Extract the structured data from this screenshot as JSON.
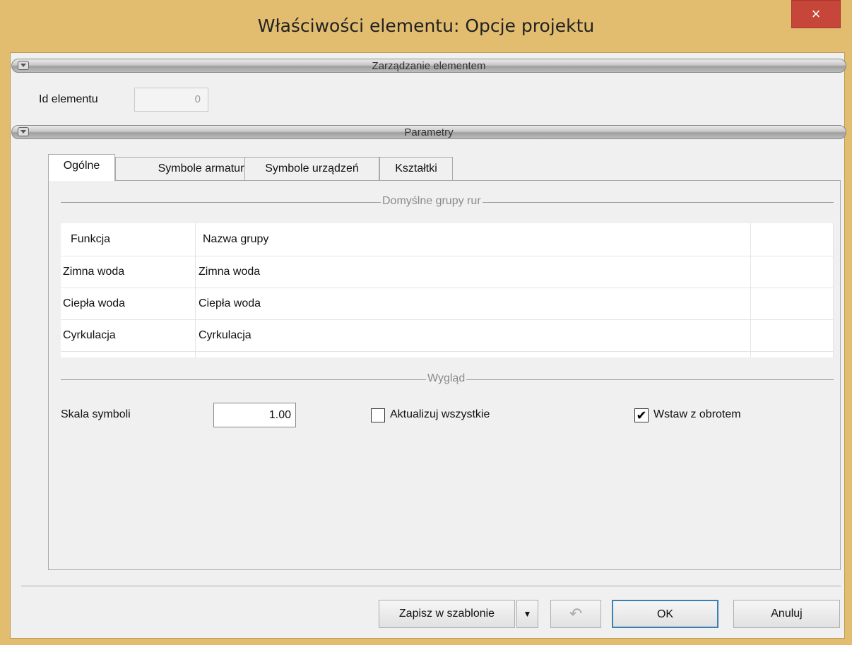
{
  "window": {
    "title": "Właściwości elementu: Opcje projektu",
    "close_glyph": "×"
  },
  "sections": {
    "management": "Zarządzanie elementem",
    "parameters": "Parametry"
  },
  "element_id": {
    "label": "Id elementu",
    "value": "0"
  },
  "tabs": [
    {
      "label": "Ogólne",
      "active": true
    },
    {
      "label": "Symbole armatury",
      "active": false
    },
    {
      "label": "Symbole urządzeń",
      "active": false
    },
    {
      "label": "Kształtki",
      "active": false
    }
  ],
  "pipe_groups": {
    "title": "Domyślne grupy rur",
    "columns": [
      "Funkcja",
      "Nazwa grupy"
    ],
    "rows": [
      {
        "function": "Zimna woda",
        "group": "Zimna woda"
      },
      {
        "function": "Ciepła woda",
        "group": "Ciepła woda"
      },
      {
        "function": "Cyrkulacja",
        "group": "Cyrkulacja"
      }
    ]
  },
  "appearance": {
    "title": "Wygląd",
    "scale_label": "Skala symboli",
    "scale_value": "1.00",
    "update_all_label": "Aktualizuj wszystkie",
    "update_all_checked": false,
    "insert_rotation_label": "Wstaw z obrotem",
    "insert_rotation_checked": true,
    "check_glyph": "✔"
  },
  "buttons": {
    "save_template": "Zapisz w szablonie",
    "dropdown_glyph": "▼",
    "undo_glyph": "↶",
    "ok": "OK",
    "cancel": "Anuluj"
  },
  "colors": {
    "title_bar": "#e2bd6f",
    "close_button": "#c7463a",
    "ok_border": "#3c7fb1"
  }
}
